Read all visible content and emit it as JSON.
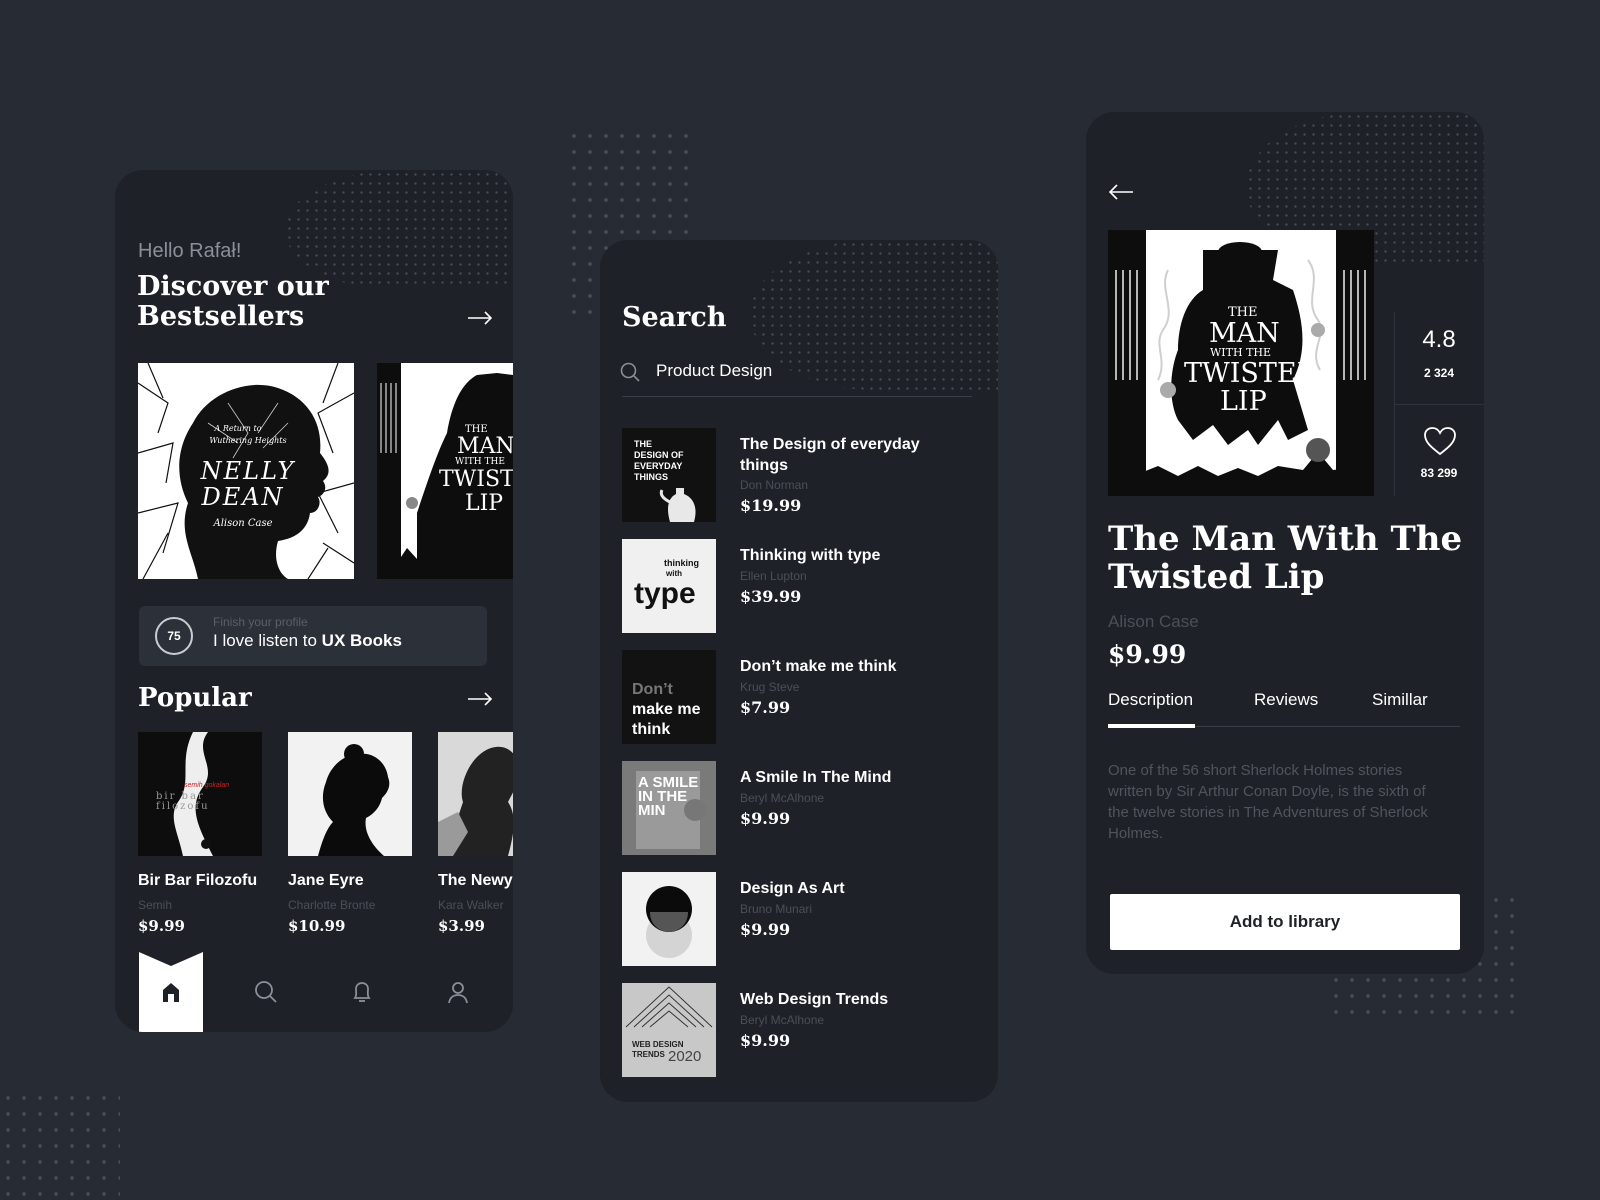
{
  "colors": {
    "background": "#272b33",
    "panel": "#1e2127",
    "card": "#2c3038",
    "accent": "#ffffff",
    "muted": "#8b8f97"
  },
  "home": {
    "greeting": "Hello Rafał!",
    "heading_line1": "Discover our",
    "heading_line2": "Bestsellers",
    "bestsellers": [
      {
        "cover_line1": "A Return to",
        "cover_line2": "Wuthering Heights",
        "cover_title1": "NELLY",
        "cover_title2": "DEAN",
        "cover_author": "Alison Case"
      },
      {
        "cover_line1": "THE",
        "cover_title1": "MAN",
        "cover_line2": "WITH THE",
        "cover_title2": "TWISTED",
        "cover_title3": "LIP"
      }
    ],
    "profile": {
      "progress": "75",
      "hint": "Finish your profile",
      "text_prefix": "I love listen to ",
      "text_bold": "UX Books"
    },
    "popular_heading": "Popular",
    "popular": [
      {
        "cover_text": "bir bar filozofu",
        "cover_small": "semih gokalan",
        "title": "Bir Bar Filozofu",
        "author": "Semih",
        "price": "$9.99"
      },
      {
        "title": "Jane Eyre",
        "author": "Charlotte Bronte",
        "price": "$10.99"
      },
      {
        "title": "The Newy",
        "author": "Kara Walker",
        "price": "$3.99"
      }
    ],
    "nav": [
      "home-icon",
      "search-icon",
      "bell-icon",
      "user-icon"
    ]
  },
  "search": {
    "title": "Search",
    "query": "Product Design",
    "results": [
      {
        "cover_text1": "THE",
        "cover_text2": "DESIGN OF",
        "cover_text3": "EVERYDAY",
        "cover_text4": "THINGS",
        "title": "The Design of everyday things",
        "author": "Don Norman",
        "price": "$19.99"
      },
      {
        "cover_small1": "thinking",
        "cover_small2": "with",
        "cover_big": "type",
        "title": "Thinking with type",
        "author": "Ellen Lupton",
        "price": "$39.99"
      },
      {
        "cover_text1": "Don’t",
        "cover_text2": "make me",
        "cover_text3": "think",
        "title": "Don’t make me think",
        "author": "Krug Steve",
        "price": "$7.99"
      },
      {
        "cover_text1": "A SMILE",
        "cover_text2": "IN THE",
        "cover_text3": "MIN",
        "title": "A Smile In The Mind",
        "author": "Beryl McAlhone",
        "price": "$9.99"
      },
      {
        "title": "Design As Art",
        "author": "Bruno Munari",
        "price": "$9.99"
      },
      {
        "cover_text1": "WEB DESIGN",
        "cover_text2": "TRENDS",
        "cover_year": "2020",
        "title": "Web Design Trends",
        "author": "Beryl McAlhone",
        "price": "$9.99"
      }
    ]
  },
  "detail": {
    "cover_line1": "THE",
    "cover_title1": "MAN",
    "cover_line2": "WITH THE",
    "cover_title2": "TWISTED",
    "cover_title3": "LIP",
    "rating": "4.8",
    "rating_count": "2 324",
    "likes": "83 299",
    "title_line1": "The Man With The",
    "title_line2": "Twisted Lip",
    "author": "Alison Case",
    "price": "$9.99",
    "tabs": [
      "Description",
      "Reviews",
      "Simillar"
    ],
    "description": "One of the 56 short Sherlock Holmes stories written by Sir Arthur Conan Doyle, is the sixth of the twelve stories in The Adventures of Sherlock Holmes.",
    "add_button": "Add to library"
  }
}
